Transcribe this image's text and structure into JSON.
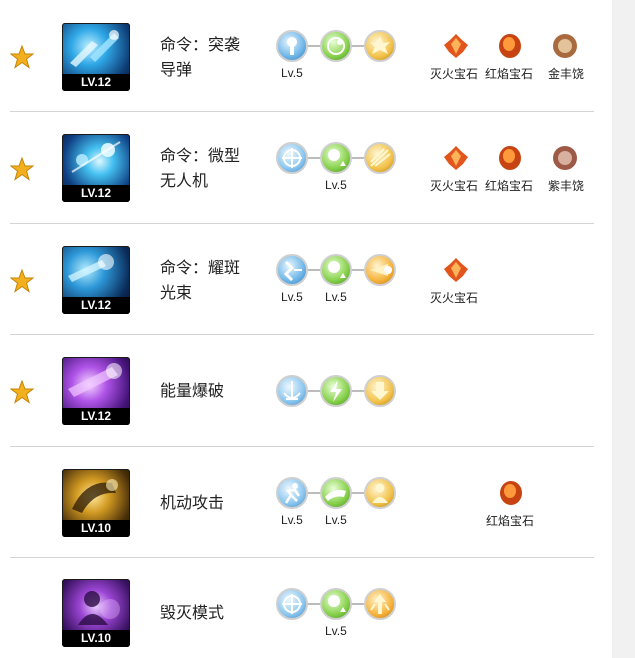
{
  "skills": [
    {
      "name_line1": "命令：突袭",
      "name_line2": "导弹",
      "level": "LV.12",
      "starred": true,
      "rune_levels": [
        "Lv.5",
        "",
        ""
      ],
      "gems": [
        "灭火宝石",
        "红焰宝石",
        "金丰饶"
      ]
    },
    {
      "name_line1": "命令：微型",
      "name_line2": "无人机",
      "level": "LV.12",
      "starred": true,
      "rune_levels": [
        "",
        "Lv.5",
        ""
      ],
      "gems": [
        "灭火宝石",
        "红焰宝石",
        "紫丰饶"
      ]
    },
    {
      "name_line1": "命令：耀斑",
      "name_line2": "光束",
      "level": "LV.12",
      "starred": true,
      "rune_levels": [
        "Lv.5",
        "Lv.5",
        ""
      ],
      "gems": [
        "灭火宝石"
      ]
    },
    {
      "name_line1": "能量爆破",
      "name_line2": "",
      "level": "LV.12",
      "starred": true,
      "rune_levels": [
        "",
        "",
        ""
      ],
      "gems": []
    },
    {
      "name_line1": "机动攻击",
      "name_line2": "",
      "level": "LV.10",
      "starred": false,
      "rune_levels": [
        "Lv.5",
        "Lv.5",
        ""
      ],
      "gems": [
        "红焰宝石"
      ]
    },
    {
      "name_line1": "毁灭模式",
      "name_line2": "",
      "level": "LV.10",
      "starred": false,
      "rune_levels": [
        "",
        "Lv.5",
        ""
      ],
      "gems": []
    }
  ]
}
